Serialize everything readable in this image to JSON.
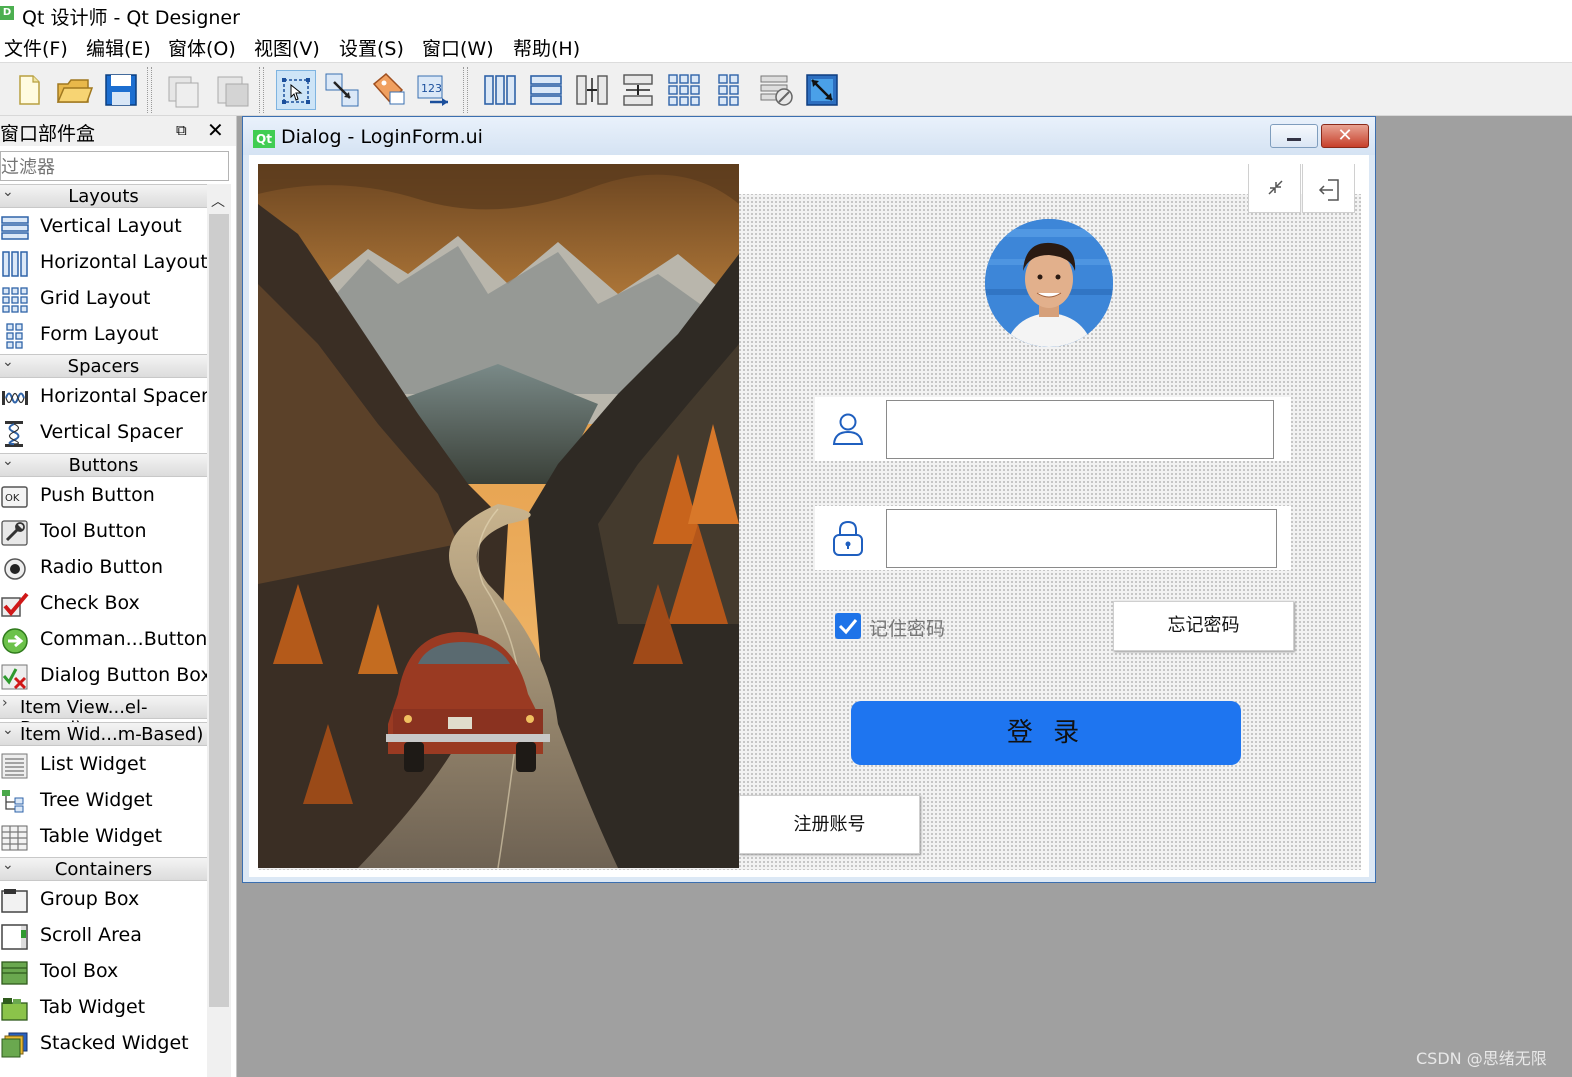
{
  "app": {
    "title": "Qt 设计师 - Qt Designer",
    "icon": "qt-designer-app-icon"
  },
  "menu": [
    "文件(F)",
    "编辑(E)",
    "窗体(O)",
    "视图(V)",
    "设置(S)",
    "窗口(W)",
    "帮助(H)"
  ],
  "toolbar": {
    "buttons": [
      "new-form-icon",
      "open-form-icon",
      "save-form-icon",
      "copy-icon",
      "paste-icon",
      "edit-widgets-icon",
      "edit-signals-slots-icon",
      "edit-buddies-icon",
      "edit-tab-order-icon",
      "lay-out-horizontally-icon",
      "lay-out-vertically-icon",
      "lay-out-horizontal-splitter-icon",
      "lay-out-vertical-splitter-icon",
      "lay-out-grid-icon",
      "lay-out-form-icon",
      "break-layout-icon",
      "adjust-size-icon"
    ],
    "active": "edit-widgets-icon"
  },
  "widget_box": {
    "title": "窗口部件盒",
    "filter_placeholder": "过滤器",
    "categories": [
      {
        "label": "Layouts",
        "expanded": true,
        "items": [
          "Vertical Layout",
          "Horizontal Layout",
          "Grid Layout",
          "Form Layout"
        ]
      },
      {
        "label": "Spacers",
        "expanded": true,
        "items": [
          "Horizontal Spacer",
          "Vertical Spacer"
        ]
      },
      {
        "label": "Buttons",
        "expanded": true,
        "items": [
          "Push Button",
          "Tool Button",
          "Radio Button",
          "Check Box",
          "Comman...Button",
          "Dialog Button Box"
        ]
      },
      {
        "label": "Item View...el-Based)",
        "expanded": false,
        "items": []
      },
      {
        "label": "Item Wid...m-Based)",
        "expanded": true,
        "items": [
          "List Widget",
          "Tree Widget",
          "Table Widget"
        ]
      },
      {
        "label": "Containers",
        "expanded": true,
        "items": [
          "Group Box",
          "Scroll Area",
          "Tool Box",
          "Tab Widget",
          "Stacked Widget"
        ]
      }
    ]
  },
  "designer_window": {
    "logo": "Qt",
    "title": "Dialog - LoginForm.ui",
    "minimize_icon": "minimize-icon",
    "close_icon": "close-icon"
  },
  "login_form": {
    "picture": "mountain-road-landscape-picture",
    "shrink_icon": "shrink-window-icon",
    "exit_icon": "exit-icon",
    "avatar": "user-avatar-photo",
    "username_icon": "user-icon",
    "username_value": "",
    "password_icon": "lock-icon",
    "password_value": "",
    "remember_checked": true,
    "remember_label": "记住密码",
    "forgot_label": "忘记密码",
    "login_label": "登 录",
    "register_label": "注册账号",
    "accent_color": "#1e75f0"
  },
  "watermark": "CSDN @思绪无限"
}
